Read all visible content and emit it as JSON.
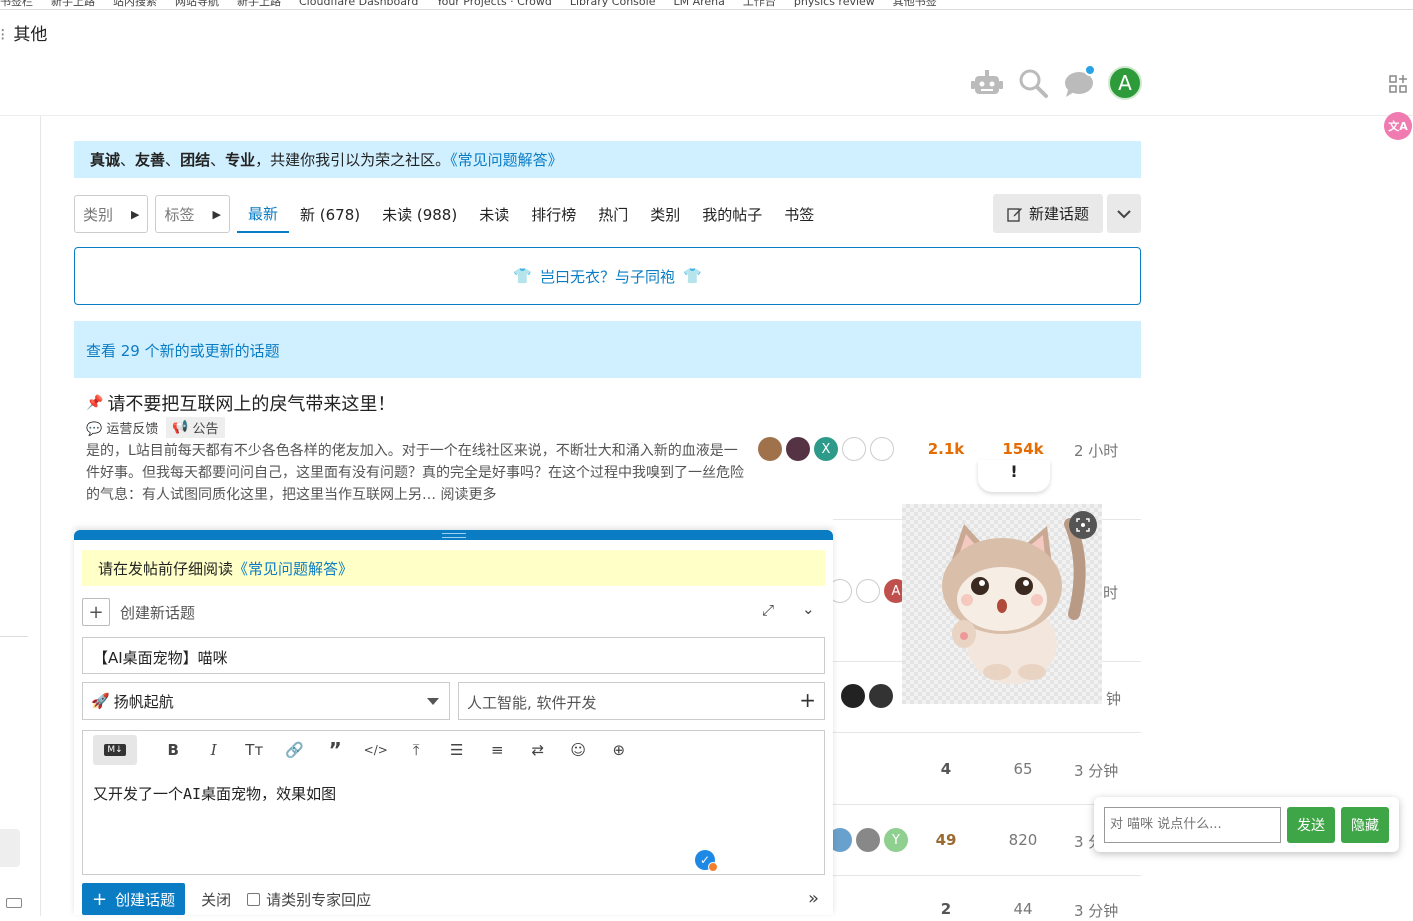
{
  "bookmarks": [
    "书签栏",
    "新手上路",
    "站内搜索",
    "网站导航",
    "新手上路",
    "Cloudflare Dashboard",
    "Your Projects · Crowd",
    "Library Console",
    "LM Arena",
    "工作台",
    "physics review",
    "其他书签"
  ],
  "folder_label": "其他",
  "banner": {
    "values": [
      "真诚",
      "、",
      "友善",
      "、",
      "团结",
      "、",
      "专业",
      "，共建你我引以为荣之社区。",
      "《常见问题解答》"
    ]
  },
  "nav": {
    "category_dd": "类别",
    "tags_dd": "标签",
    "tabs": [
      "最新",
      "新 (678)",
      "未读 (988)",
      "未读",
      "排行榜",
      "热门",
      "类别",
      "我的帖子",
      "书签"
    ],
    "new_topic": "新建话题"
  },
  "slogan": "岂曰无衣？与子同袍",
  "new_topics_notice": "查看 29 个新的或更新的话题",
  "pinned": {
    "title": "请不要把互联网上的戾气带来这里！",
    "category": "运营反馈",
    "tag": "公告",
    "excerpt": "是的，L站目前每天都有不少各色各样的佬友加入。对于一个在线社区来说，不断壮大和涌入新的血液是一件好事。但我每天都要问问自己，这里面有没有问题？真的完全是好事吗？在这个过程中我嗅到了一丝危险的气息：有人试图同质化这里，把这里当作互联网上另… 阅读更多",
    "replies": "2.1k",
    "views": "154k",
    "activity": "2 小时"
  },
  "rows": [
    {
      "activity": "时"
    },
    {
      "activity": "钟"
    },
    {
      "replies": "4",
      "views": "65",
      "activity": "3 分钟"
    },
    {
      "replies": "49",
      "views": "820",
      "activity": "3 分"
    },
    {
      "replies": "2",
      "views": "44",
      "activity": "3 分钟"
    }
  ],
  "tooltip": "!",
  "chat": {
    "placeholder": "对 喵咪 说点什么...",
    "send": "发送",
    "hide": "隐藏"
  },
  "composer": {
    "notice_prefix": "请在发帖前仔细阅读",
    "notice_link": "《常见问题解答》",
    "action_label": "创建新话题",
    "title_value": "【AI桌面宠物】喵咪",
    "category": "扬帆起航",
    "tags": "人工智能, 软件开发",
    "body": "又开发了一个AI桌面宠物，效果如图",
    "create_button": "创建话题",
    "close": "关闭",
    "expert": "请类别专家回应"
  },
  "colors": {
    "accent": "#0a7cc4",
    "banner_bg": "#d1f0ff",
    "notice_bg": "#ffffc8",
    "green": "#3fa648",
    "orange": "#e66b00"
  }
}
